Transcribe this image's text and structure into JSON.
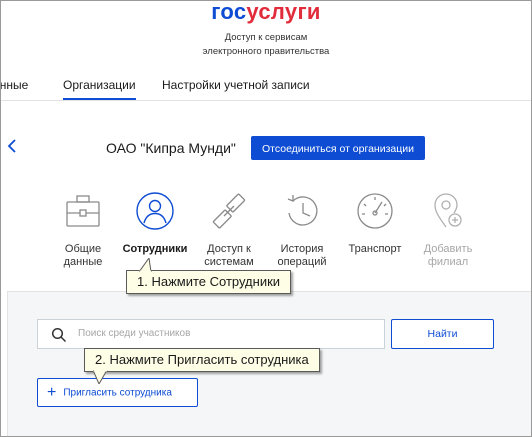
{
  "header": {
    "logo_part1": "гос",
    "logo_part2": "услуги",
    "subtitle_line1": "Доступ к сервисам",
    "subtitle_line2": "электронного правительства"
  },
  "tabs": [
    {
      "label": "Данные",
      "active": false
    },
    {
      "label": "Организации",
      "active": true
    },
    {
      "label": "Настройки учетной записи",
      "active": false
    }
  ],
  "org": {
    "name": "ОАО \"Кипра Мунди\"",
    "disconnect_label": "Отсоединиться от организации"
  },
  "categories": [
    {
      "icon": "briefcase-icon",
      "line1": "Общие",
      "line2": "данные",
      "active": false,
      "disabled": false
    },
    {
      "icon": "user-icon",
      "line1": "Сотрудники",
      "line2": "",
      "active": true,
      "disabled": false
    },
    {
      "icon": "link-icon",
      "line1": "Доступ к",
      "line2": "системам",
      "active": false,
      "disabled": false
    },
    {
      "icon": "history-icon",
      "line1": "История",
      "line2": "операций",
      "active": false,
      "disabled": false
    },
    {
      "icon": "speedometer-icon",
      "line1": "Транспорт",
      "line2": "",
      "active": false,
      "disabled": false
    },
    {
      "icon": "add-location-icon",
      "line1": "Добавить",
      "line2": "филиал",
      "active": false,
      "disabled": true
    }
  ],
  "search": {
    "placeholder": "Поиск среди участников",
    "find_label": "Найти"
  },
  "invite": {
    "label": "Пригласить сотрудника"
  },
  "callouts": {
    "step1": "1. Нажмите Сотрудники",
    "step2": "2. Нажмите Пригласить сотрудника"
  },
  "colors": {
    "brand_blue": "#0d4cd3",
    "brand_red": "#e12c3c",
    "callout_bg": "#fefde6"
  }
}
